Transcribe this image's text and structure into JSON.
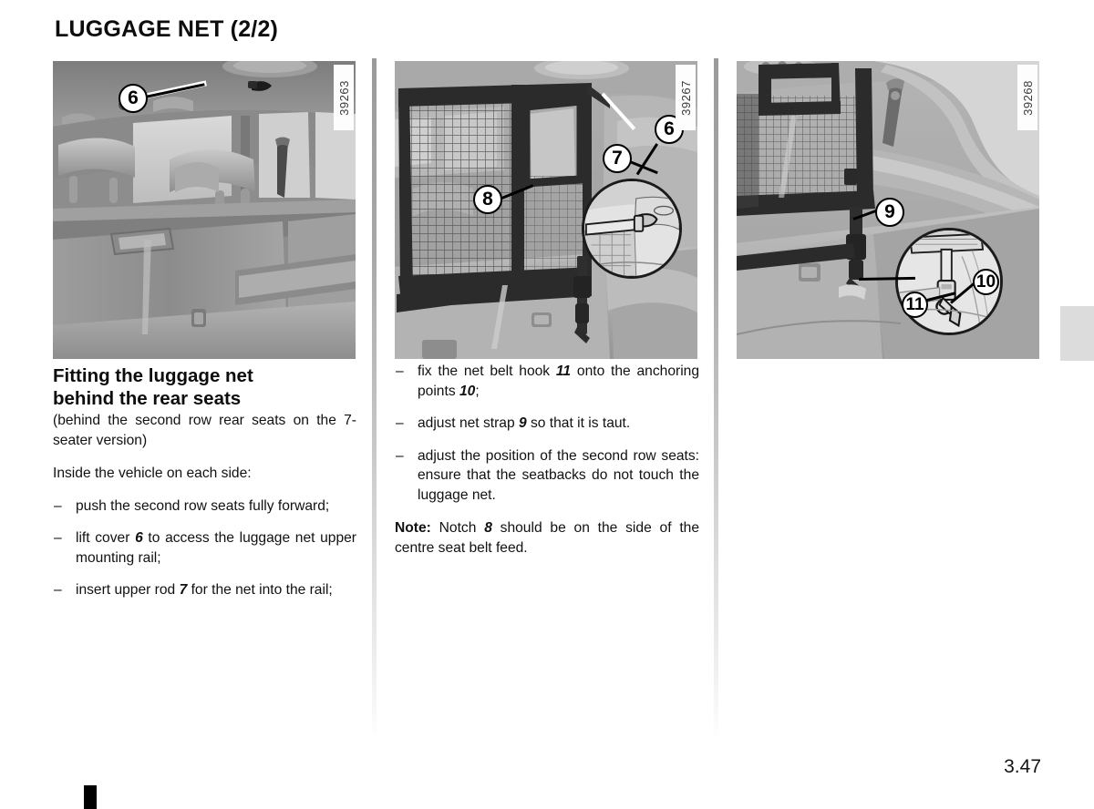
{
  "page": {
    "title": "LUGGAGE NET (2/2)",
    "number": "3.47"
  },
  "figures": [
    {
      "ref": "39263",
      "name": "luggage-net-upper-rail-cover",
      "callouts": [
        {
          "label": "6",
          "name": "callout-6"
        }
      ]
    },
    {
      "ref": "39267",
      "name": "luggage-net-fitted-behind-rear-seats",
      "callouts": [
        {
          "label": "8",
          "name": "callout-8"
        },
        {
          "label": "7",
          "name": "callout-7"
        },
        {
          "label": "6",
          "name": "callout-6"
        }
      ]
    },
    {
      "ref": "39268",
      "name": "luggage-net-strap-and-anchoring-points",
      "callouts": [
        {
          "label": "9",
          "name": "callout-9"
        },
        {
          "label": "10",
          "name": "callout-10"
        },
        {
          "label": "11",
          "name": "callout-11"
        }
      ]
    }
  ],
  "left_column": {
    "heading_line_1": "Fitting the luggage net",
    "heading_line_2": "behind the rear seats",
    "subtitle": "(behind the second row rear seats on the 7-seater version)",
    "intro": "Inside the vehicle on each side:",
    "dash": "–",
    "items": [
      {
        "before": "push the second row seats fully forward;",
        "ref": "",
        "after": ""
      },
      {
        "before": "lift cover ",
        "ref": "6",
        "after": " to access the luggage net upper mounting rail;"
      },
      {
        "before": "insert upper rod ",
        "ref": "7",
        "after": " for the net into the rail;"
      }
    ]
  },
  "middle_column": {
    "dash": "–",
    "items": [
      {
        "p1": "fix the net belt hook ",
        "r1": "11",
        "p2": " onto the anchoring points ",
        "r2": "10",
        "p3": ";"
      },
      {
        "p1": "adjust net strap ",
        "r1": "9",
        "p2": " so that it is taut.",
        "r2": "",
        "p3": ""
      },
      {
        "p1": "adjust the position of the second row seats: ensure that the seatbacks do not touch the luggage net.",
        "r1": "",
        "p2": "",
        "r2": "",
        "p3": ""
      }
    ],
    "note_label": "Note:",
    "note_before": " Notch ",
    "note_ref": "8",
    "note_after": " should be on the side of the centre seat belt feed."
  }
}
